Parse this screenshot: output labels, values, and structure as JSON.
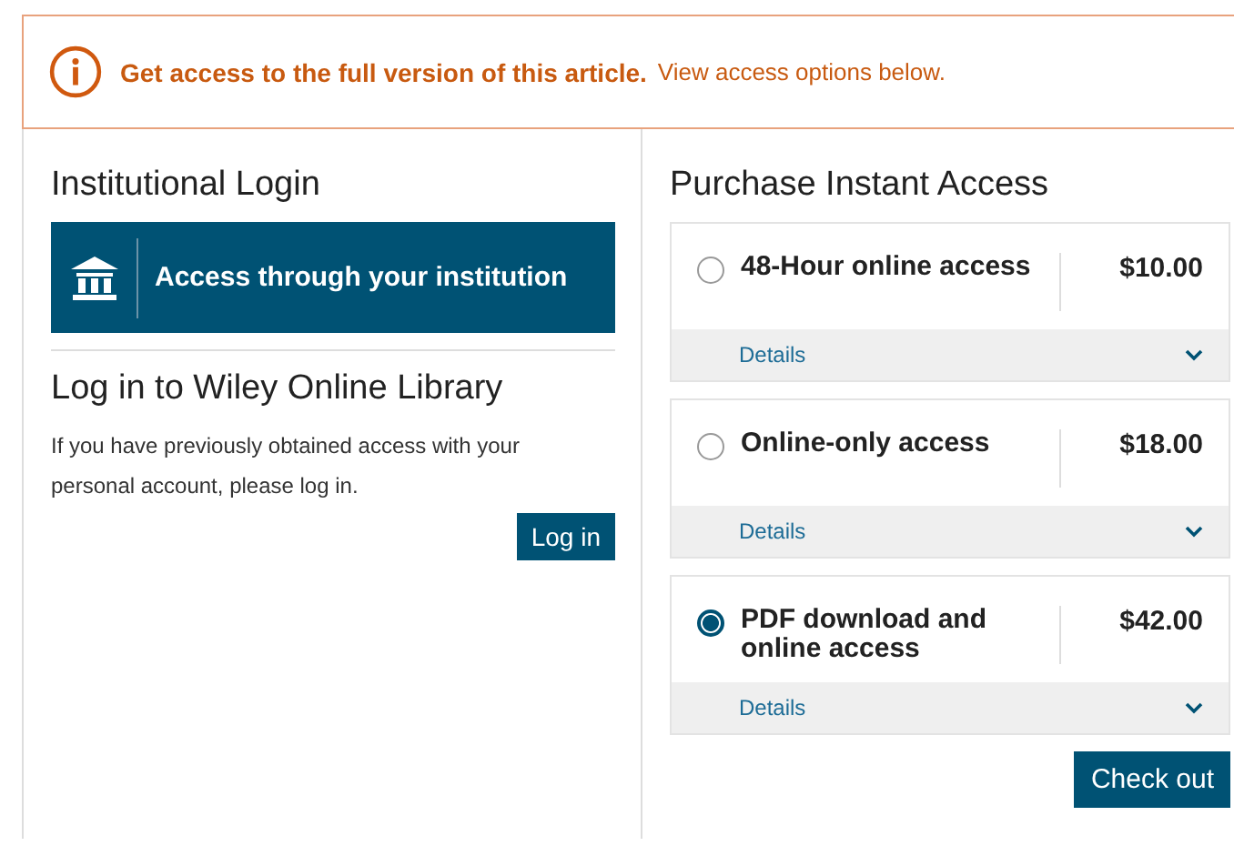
{
  "banner": {
    "headline": "Get access to the full version of this article.",
    "text": "View access options below."
  },
  "institutional": {
    "title": "Institutional Login",
    "button": "Access through your institution"
  },
  "login": {
    "title": "Log in to Wiley Online Library",
    "text": "If you have previously obtained access with your personal account, please log in.",
    "button": "Log in"
  },
  "purchase": {
    "title": "Purchase Instant Access",
    "options": [
      {
        "label": "48-Hour online access",
        "price": "$10.00",
        "details": "Details",
        "selected": false
      },
      {
        "label": "Online-only access",
        "price": "$18.00",
        "details": "Details",
        "selected": false
      },
      {
        "label": "PDF download and online access",
        "price": "$42.00",
        "details": "Details",
        "selected": true
      }
    ],
    "button": "Check out"
  }
}
